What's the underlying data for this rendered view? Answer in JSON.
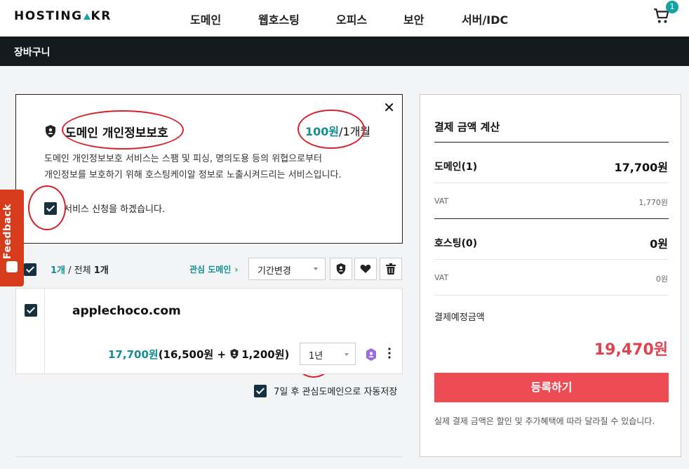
{
  "header": {
    "logo": {
      "left": "HOSTING",
      "right": "KR"
    },
    "nav": [
      "도메인",
      "웹호스팅",
      "오피스",
      "보안",
      "서버/IDC"
    ],
    "cart_count": "1",
    "accent": "#14a3a3"
  },
  "subbar": {
    "title": "장바구니"
  },
  "privacy": {
    "title": "도메인 개인정보보호",
    "price": "100원",
    "period": "/1개월",
    "desc1": "도메인 개인정보보호 서비스는 스팸 및 피싱, 명의도용 등의 위협으로부터",
    "desc2": "개인정보를 보호하기 위해 호스팅케이알 정보로 노출시켜드리는 서비스입니다.",
    "agree": "서비스 신청을 하겠습니다.",
    "close": "✕"
  },
  "feedback": {
    "label": "Feedback"
  },
  "toolbar": {
    "selected": "1개",
    "separator": " / 전체 ",
    "total": "1개",
    "interest_link": "관심 도메인",
    "period_label": "기간변경"
  },
  "domain": {
    "name": "applechoco.com",
    "price": "17,700원",
    "breakdown_open": "(16,500원 + ",
    "privacy_fee": "1,200원",
    "breakdown_close": ")",
    "year": "1년"
  },
  "autosave": {
    "label": "7일 후 관심도메인으로 자동저장"
  },
  "summary": {
    "title": "결제 금액 계산",
    "domain_label": "도메인(1)",
    "domain_value": "17,700원",
    "vat_label": "VAT",
    "domain_vat": "1,770원",
    "hosting_label": "호스팅(0)",
    "hosting_value": "0원",
    "hosting_vat": "0원",
    "estimate_label": "결제예정금액",
    "total": "19,470원",
    "register_button": "등록하기",
    "note": "실제 결제 금액은 할인 및 추가혜택에 따라 달라질 수 있습니다.",
    "total_color": "#e0424f"
  }
}
